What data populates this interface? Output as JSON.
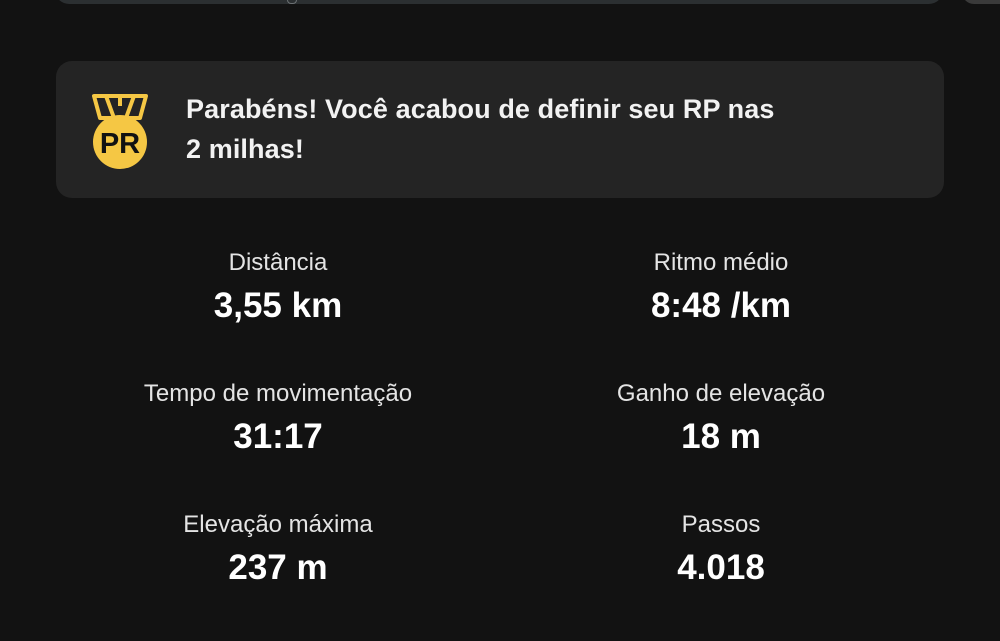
{
  "pr_banner": {
    "badge_text": "PR",
    "message_line1": "Parabéns! Você acabou de definir seu RP nas",
    "message_line2": "2 milhas!",
    "badge_color": "#F5C744"
  },
  "stats": [
    {
      "label": "Distância",
      "value": "3,55 km"
    },
    {
      "label": "Ritmo médio",
      "value": "8:48 /km"
    },
    {
      "label": "Tempo de movimentação",
      "value": "31:17"
    },
    {
      "label": "Ganho de elevação",
      "value": "18 m"
    },
    {
      "label": "Elevação máxima",
      "value": "237 m"
    },
    {
      "label": "Passos",
      "value": "4.018"
    }
  ],
  "theme": {
    "background": "#121212",
    "card": "#242424"
  }
}
